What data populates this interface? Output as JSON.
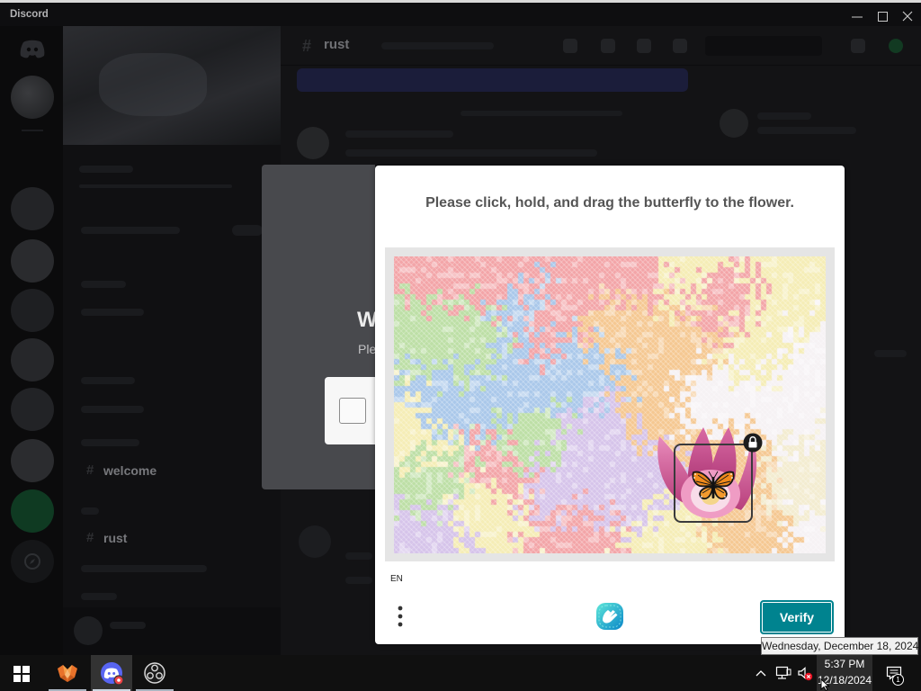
{
  "window": {
    "title": "Discord",
    "controls": [
      "minimize-icon",
      "maximize-icon",
      "close-icon"
    ]
  },
  "discord": {
    "header": {
      "channel_name": "rust"
    },
    "sidebar": {
      "channels": [
        "welcome",
        "rust"
      ]
    }
  },
  "verification_modal": {
    "heading": "W",
    "subtext": "Ple"
  },
  "captcha": {
    "prompt": "Please click, hold, and drag the butterfly to the flower.",
    "language": "EN",
    "verify_label": "Verify",
    "icons": {
      "menu": "more-vertical-icon",
      "logo": "hcaptcha-logo-icon",
      "lock": "lock-icon",
      "drag_piece": "butterfly-icon",
      "target": "flower-icon"
    },
    "colors": {
      "accent": "#00838f",
      "prompt_text": "#555555",
      "panel": "#ffffff"
    }
  },
  "taskbar": {
    "apps": [
      {
        "icon": "orange-fox-app-icon",
        "running": true,
        "active": false
      },
      {
        "icon": "discord-app-icon",
        "running": true,
        "active": true
      },
      {
        "icon": "obs-app-icon",
        "running": true,
        "active": false
      }
    ],
    "tray_icons": [
      "chevron-up-icon",
      "network-icon",
      "volume-muted-icon"
    ],
    "clock": {
      "time": "5:37 PM",
      "date": "12/18/2024"
    },
    "tooltip": "Wednesday, December 18, 2024",
    "notification_count": "1"
  }
}
